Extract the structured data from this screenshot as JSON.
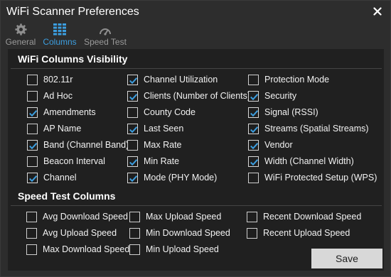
{
  "window": {
    "title": "WiFi Scanner Preferences"
  },
  "tabs": [
    {
      "label": "General",
      "icon": "gear-icon"
    },
    {
      "label": "Columns",
      "icon": "columns-icon"
    },
    {
      "label": "Speed Test",
      "icon": "gauge-icon"
    }
  ],
  "active_tab": "Columns",
  "accent_color": "#3c9ee0",
  "wifi_section": {
    "title": "WiFi Columns Visibility",
    "columns": [
      [
        {
          "label": "802.11r",
          "checked": false
        },
        {
          "label": "Ad Hoc",
          "checked": false
        },
        {
          "label": "Amendments",
          "checked": true
        },
        {
          "label": "AP Name",
          "checked": false
        },
        {
          "label": "Band (Channel Band)",
          "checked": true
        },
        {
          "label": "Beacon Interval",
          "checked": false
        },
        {
          "label": "Channel",
          "checked": true
        }
      ],
      [
        {
          "label": "Channel Utilization",
          "checked": true
        },
        {
          "label": "Clients (Number of Clients)",
          "checked": true
        },
        {
          "label": "County Code",
          "checked": false
        },
        {
          "label": "Last Seen",
          "checked": true
        },
        {
          "label": "Max Rate",
          "checked": false
        },
        {
          "label": "Min Rate",
          "checked": true
        },
        {
          "label": "Mode (PHY Mode)",
          "checked": true
        }
      ],
      [
        {
          "label": "Protection Mode",
          "checked": false
        },
        {
          "label": "Security",
          "checked": true
        },
        {
          "label": "Signal (RSSI)",
          "checked": true
        },
        {
          "label": "Streams (Spatial Streams)",
          "checked": true
        },
        {
          "label": "Vendor",
          "checked": true
        },
        {
          "label": "Width (Channel Width)",
          "checked": true
        },
        {
          "label": "WiFi Protected Setup (WPS)",
          "checked": false
        }
      ]
    ]
  },
  "speed_section": {
    "title": "Speed Test Columns",
    "columns": [
      [
        {
          "label": "Avg Download Speed",
          "checked": false
        },
        {
          "label": "Avg Upload Speed",
          "checked": false
        },
        {
          "label": "Max Download Speed",
          "checked": false
        }
      ],
      [
        {
          "label": "Max Upload Speed",
          "checked": false
        },
        {
          "label": "Min Download Speed",
          "checked": false
        },
        {
          "label": "Min Upload Speed",
          "checked": false
        }
      ],
      [
        {
          "label": "Recent Download Speed",
          "checked": false
        },
        {
          "label": "Recent Upload Speed",
          "checked": false
        }
      ]
    ]
  },
  "footer": {
    "save_label": "Save"
  }
}
